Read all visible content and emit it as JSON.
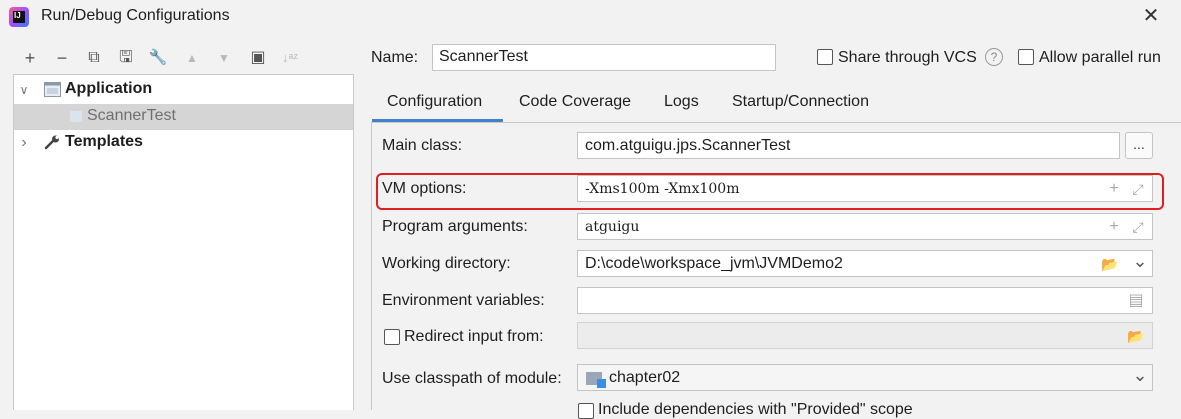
{
  "window": {
    "title": "Run/Debug Configurations",
    "app_icon_text": "IJ",
    "close_glyph": "✕"
  },
  "toolbar": {
    "buttons": [
      {
        "name": "add-icon",
        "glyph": "+"
      },
      {
        "name": "remove-icon",
        "glyph": "−"
      },
      {
        "name": "copy-icon",
        "glyph": "⧉"
      },
      {
        "name": "save-icon",
        "glyph": "🖫"
      },
      {
        "name": "wrench-icon",
        "glyph": "🔧"
      },
      {
        "name": "move-up-icon",
        "glyph": "▲"
      },
      {
        "name": "move-down-icon",
        "glyph": "▼"
      },
      {
        "name": "folder-add-icon",
        "glyph": "▣"
      },
      {
        "name": "sort-icon",
        "glyph": "↓ᵃᶻ"
      }
    ]
  },
  "tree": {
    "application": {
      "label": "Application",
      "chevron": "∨"
    },
    "scanner_test": {
      "label": "ScannerTest"
    },
    "templates": {
      "label": "Templates",
      "chevron": "›"
    }
  },
  "header": {
    "name_label": "Name:",
    "name_value": "ScannerTest",
    "share_label": "Share through VCS",
    "help_glyph": "?",
    "parallel_label": "Allow parallel run"
  },
  "tabs": [
    {
      "label": "Configuration",
      "active": true
    },
    {
      "label": "Code Coverage",
      "active": false
    },
    {
      "label": "Logs",
      "active": false
    },
    {
      "label": "Startup/Connection",
      "active": false
    }
  ],
  "form": {
    "main_class": {
      "label": "Main class:",
      "value": "com.atguigu.jps.ScannerTest",
      "button": "..."
    },
    "vm_options": {
      "label": "VM options:",
      "value": "-Xms100m -Xmx100m"
    },
    "program_arguments": {
      "label": "Program arguments:",
      "value": "atguigu"
    },
    "working_directory": {
      "label": "Working directory:",
      "value": "D:\\code\\workspace_jvm\\JVMDemo2"
    },
    "environment_variables": {
      "label": "Environment variables:",
      "value": ""
    },
    "redirect_input": {
      "label": "Redirect input from:",
      "value": ""
    },
    "classpath_module": {
      "label": "Use classpath of module:",
      "value": "chapter02"
    },
    "include_dependencies": {
      "label": "Include dependencies with \"Provided\" scope"
    }
  },
  "icons": {
    "plus": "+",
    "expand": "⤢",
    "folder": "📂",
    "dropdown": "⌄",
    "doc": "▤"
  },
  "colors": {
    "highlight": "#e02020",
    "tab_accent": "#4083c9",
    "selection": "#d5d5d5"
  }
}
